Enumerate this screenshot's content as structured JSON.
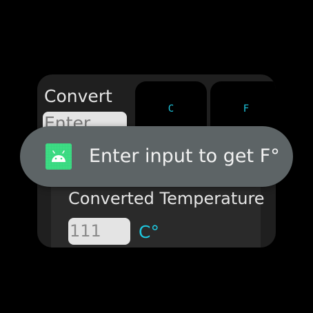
{
  "converter": {
    "convert_label": "Convert",
    "input_value": "Enter",
    "button_c": "C",
    "button_f": "F",
    "converted_label": "Converted Temperature",
    "result_value": "111",
    "result_unit": "C°"
  },
  "toast": {
    "icon": "android-icon",
    "message": "Enter input to get F°"
  },
  "colors": {
    "accent": "#1ec8e0",
    "android_green": "#3ddc84"
  }
}
